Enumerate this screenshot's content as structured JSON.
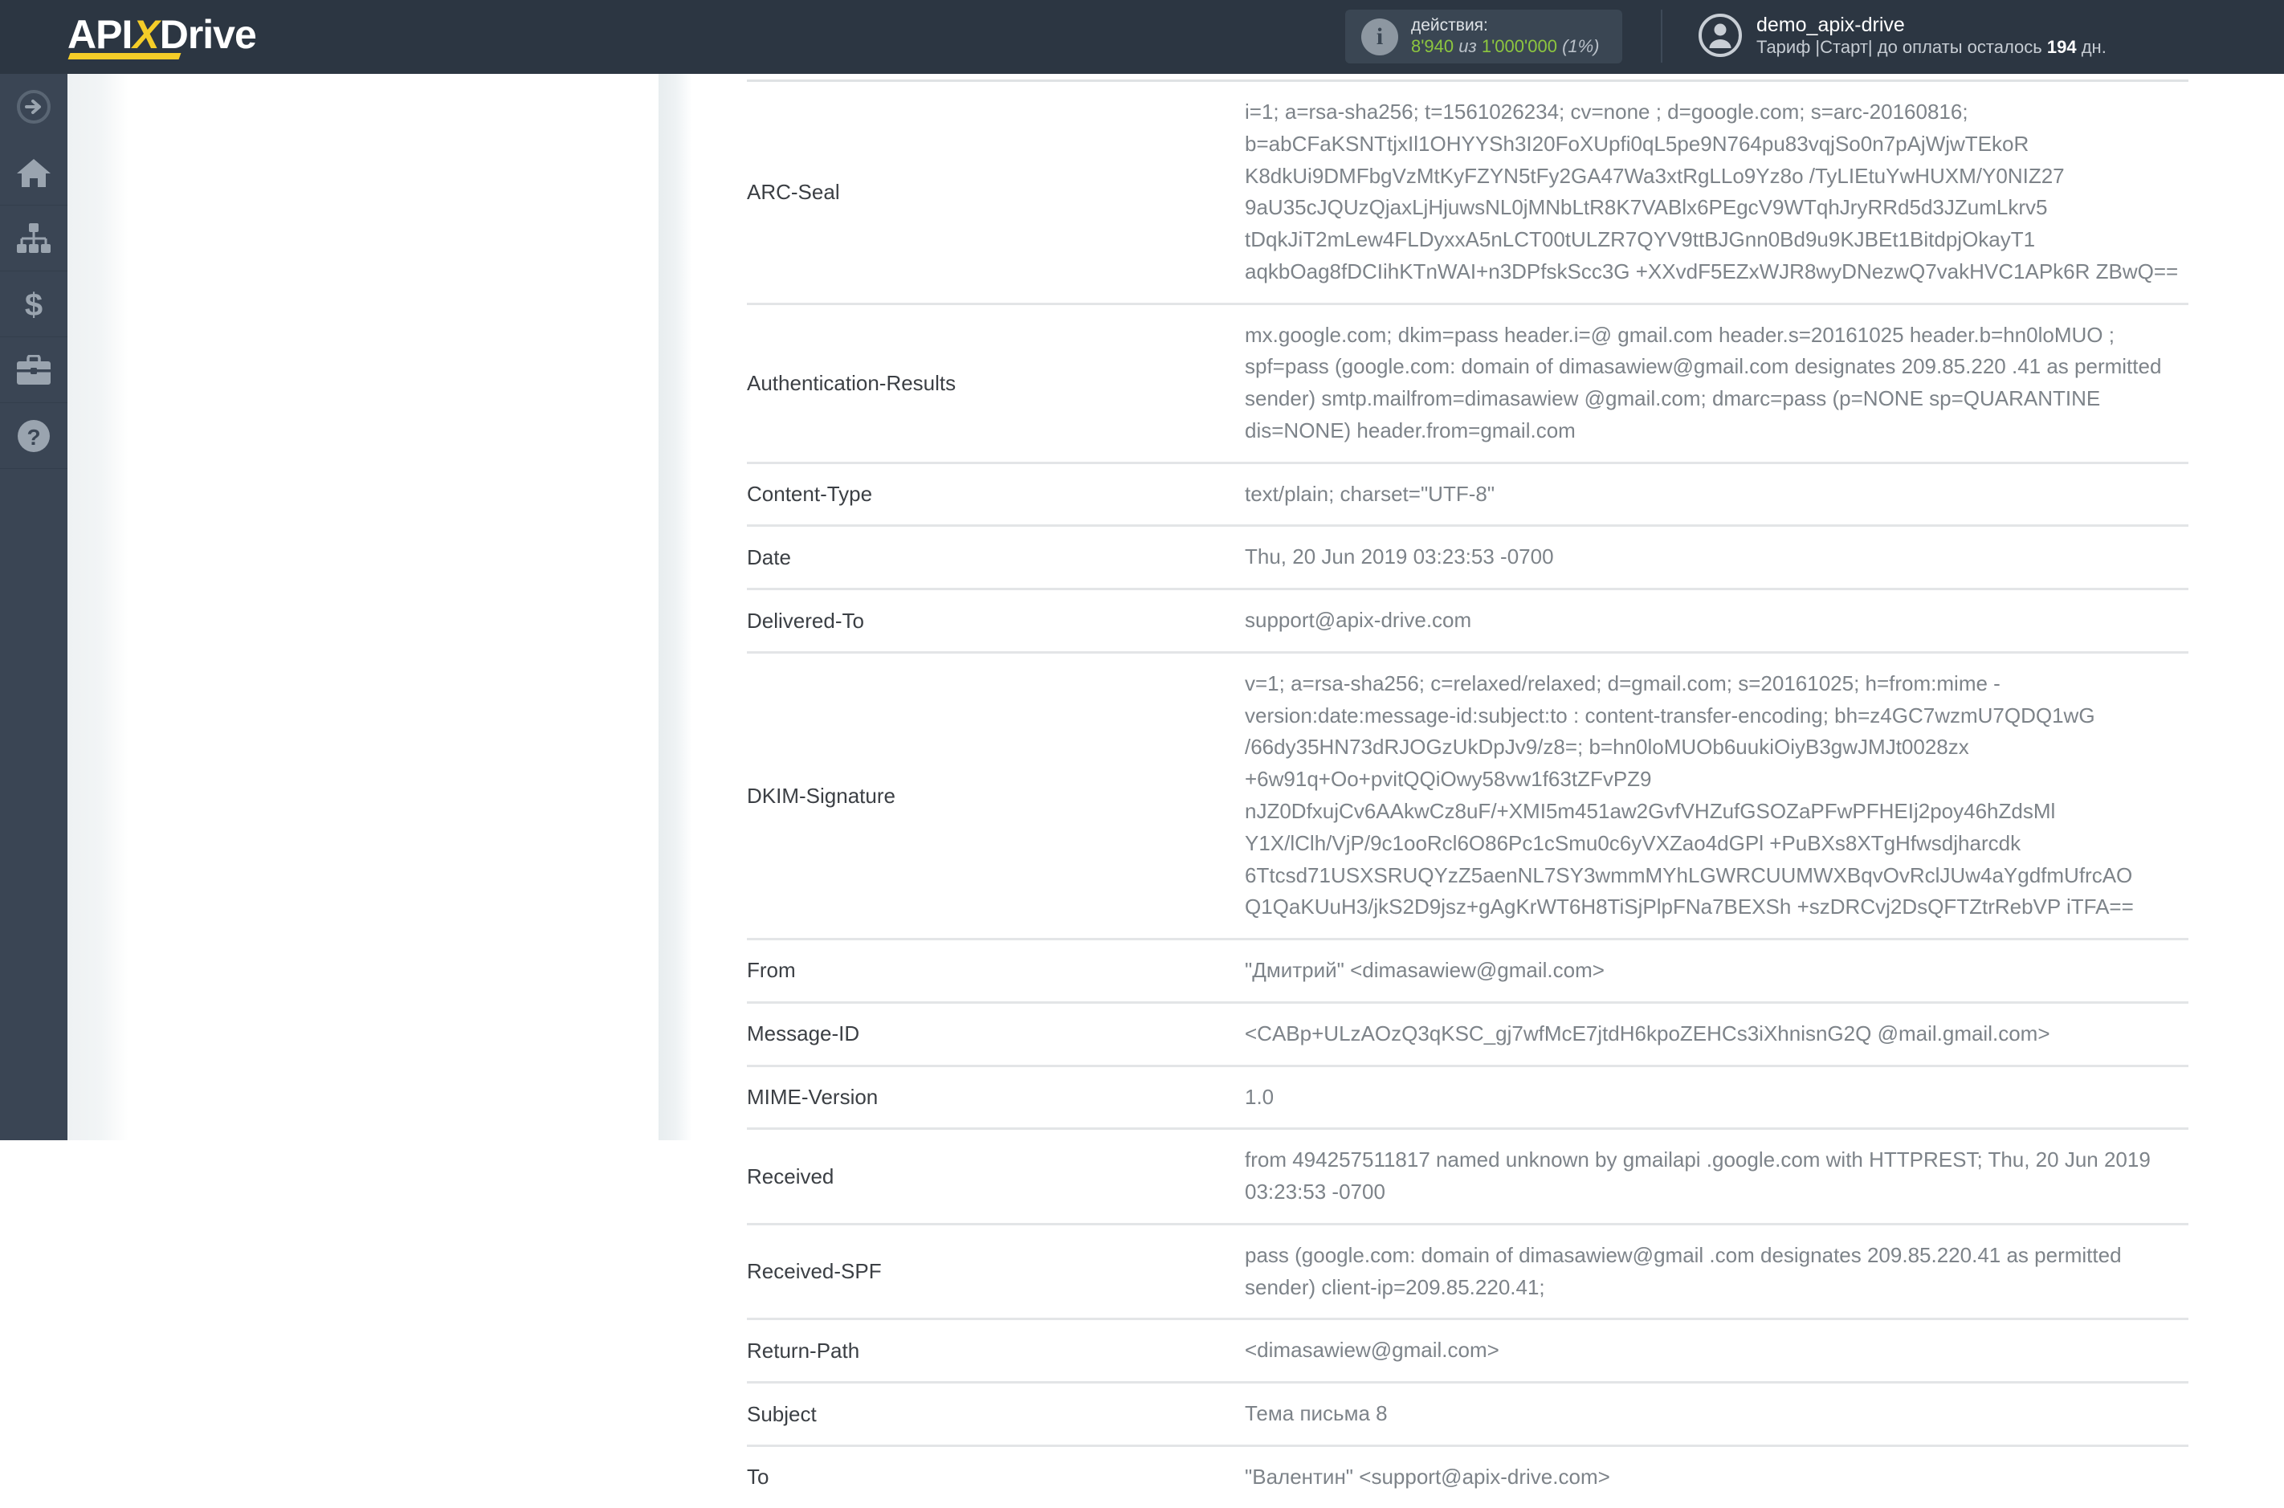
{
  "header": {
    "logo": {
      "pre": "API",
      "x": "X",
      "post": "Drive"
    },
    "actions": {
      "icon": "info-icon",
      "label": "действия:",
      "used": "8'940",
      "separator": "из",
      "total": "1'000'000",
      "percent": "(1%)"
    },
    "user": {
      "avatar_icon": "user-avatar-icon",
      "name": "demo_apix-drive",
      "plan_prefix": "Тариф |Старт| до оплаты осталось",
      "plan_days": "194",
      "plan_suffix": "дн."
    }
  },
  "sidebar": {
    "items": [
      {
        "icon": "arrow-right-circle-icon",
        "name": "sidebar-item-expand"
      },
      {
        "icon": "home-icon",
        "name": "sidebar-item-home"
      },
      {
        "icon": "sitemap-icon",
        "name": "sidebar-item-connections"
      },
      {
        "icon": "dollar-icon",
        "name": "sidebar-item-billing"
      },
      {
        "icon": "briefcase-icon",
        "name": "sidebar-item-partners"
      },
      {
        "icon": "question-circle-icon",
        "name": "sidebar-item-help"
      }
    ]
  },
  "headers_table": {
    "rows": [
      {
        "key": "ARC-Seal",
        "value": "i=1; a=rsa-sha256; t=1561026234; cv=none ; d=google.com; s=arc-20160816; b=abCFaKSNTtjxIl1OHYYSh3I20FoXUpfi0qL5pe9N764pu83vqjSo0n7pAjWjwTEkoR K8dkUi9DMFbgVzMtKyFZYN5tFy2GA47Wa3xtRgLLo9Yz8o /TyLIEtuYwHUXM/Y0NIZ27 9aU35cJQUzQjaxLjHjuwsNL0jMNbLtR8K7VABlx6PEgcV9WTqhJryRRd5d3JZumLkrv5 tDqkJiT2mLew4FLDyxxA5nLCT00tULZR7QYV9ttBJGnn0Bd9u9KJBEt1BitdpjOkayT1 aqkbOag8fDCIihKTnWAI+n3DPfskScc3G +XXvdF5EZxWJR8wyDNezwQ7vakHVC1APk6R ZBwQ=="
      },
      {
        "key": "Authentication-Results",
        "value": "mx.google.com; dkim=pass header.i=@ gmail.com header.s=20161025 header.b=hn0loMUO ; spf=pass (google.com: domain of dimasawiew@gmail.com designates 209.85.220 .41 as permitted sender) smtp.mailfrom=dimasawiew @gmail.com; dmarc=pass (p=NONE sp=QUARANTINE dis=NONE) header.from=gmail.com"
      },
      {
        "key": "Content-Type",
        "value": "text/plain; charset=\"UTF-8\""
      },
      {
        "key": "Date",
        "value": "Thu, 20 Jun 2019 03:23:53 -0700"
      },
      {
        "key": "Delivered-To",
        "value": "support@apix-drive.com"
      },
      {
        "key": "DKIM-Signature",
        "value": "v=1; a=rsa-sha256; c=relaxed/relaxed; d=gmail.com; s=20161025; h=from:mime -version:date:message-id:subject:to : content-transfer-encoding; bh=z4GC7wzmU7QDQ1wG /66dy35HN73dRJOGzUkDpJv9/z8=; b=hn0loMUOb6uukiOiyB3gwJMJt0028zx +6w91q+Oo+pvitQQiOwy58vw1f63tZFvPZ9 nJZ0DfxujCv6AAkwCz8uF/+XMI5m451aw2GvfVHZufGSOZaPFwPFHEIj2poy46hZdsMl Y1X/lClh/VjP/9c1ooRcl6O86Pc1cSmu0c6yVXZao4dGPl +PuBXs8XTgHfwsdjharcdk 6Ttcsd71USXSRUQYzZ5aenNL7SY3wmmMYhLGWRCUUMWXBqvOvRclJUw4aYgdfmUfrcAO Q1QaKUuH3/jkS2D9jsz+gAgKrWT6H8TiSjPlpFNa7BEXSh +szDRCvj2DsQFTZtrRebVP iTFA=="
      },
      {
        "key": "From",
        "value": "\"Дмитрий\" <dimasawiew@gmail.com>"
      },
      {
        "key": "Message-ID",
        "value": "<CABp+ULzAOzQ3qKSC_gj7wfMcE7jtdH6kpoZEHCs3iXhnisnG2Q @mail.gmail.com>"
      },
      {
        "key": "MIME-Version",
        "value": "1.0"
      },
      {
        "key": "Received",
        "value": "from 494257511817 named unknown by gmailapi .google.com with HTTPREST; Thu, 20 Jun 2019 03:23:53 -0700"
      },
      {
        "key": "Received-SPF",
        "value": "pass (google.com: domain of dimasawiew@gmail .com designates 209.85.220.41 as permitted sender) client-ip=209.85.220.41;"
      },
      {
        "key": "Return-Path",
        "value": "<dimasawiew@gmail.com>"
      },
      {
        "key": "Subject",
        "value": "Тема письма 8"
      },
      {
        "key": "To",
        "value": "\"Валентин\" <support@apix-drive.com>"
      }
    ]
  },
  "colors": {
    "header_bg": "#2c3642",
    "sidebar_bg": "#3a4554",
    "accent_yellow": "#f5cd28",
    "accent_green": "#8dc63f",
    "text_key": "#3b3f44",
    "text_value": "#7d8389"
  }
}
